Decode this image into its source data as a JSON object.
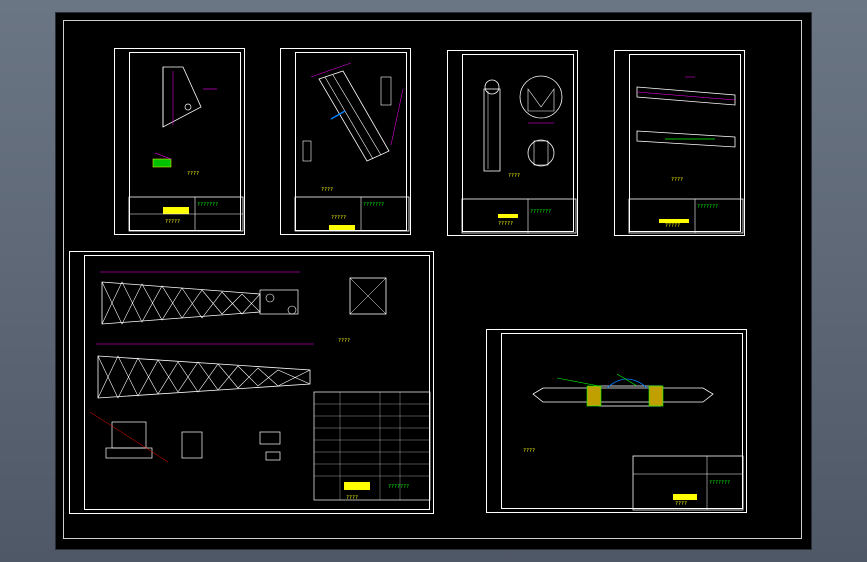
{
  "sheets": [
    {
      "id": "sheet-1",
      "title": "???????",
      "code": "?????",
      "note": "????"
    },
    {
      "id": "sheet-2",
      "title": "???????",
      "code": "?????",
      "note": "????"
    },
    {
      "id": "sheet-3",
      "title": "???????",
      "code": "?????",
      "note": "????"
    },
    {
      "id": "sheet-4",
      "title": "???????",
      "code": "?????",
      "note": "????"
    },
    {
      "id": "sheet-5",
      "title": "???????",
      "code": "????",
      "note": "????"
    },
    {
      "id": "sheet-6",
      "title": "???????",
      "code": "????",
      "note": "????"
    }
  ],
  "colors": {
    "background": "#000000",
    "frame": "#ffffff",
    "accent": "#ffff00",
    "dim": "#ff00ff",
    "label": "#00ff00",
    "line": "#ffffff"
  }
}
